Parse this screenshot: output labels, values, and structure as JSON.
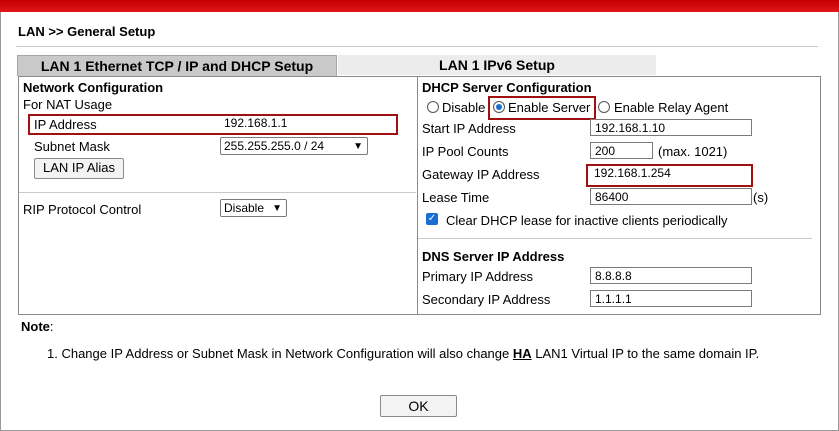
{
  "breadcrumb": "LAN >> General Setup",
  "tabs": [
    {
      "label": "LAN 1 Ethernet TCP / IP and DHCP Setup",
      "active": true
    },
    {
      "label": "LAN 1 IPv6 Setup",
      "active": false
    }
  ],
  "network": {
    "title": "Network Configuration",
    "nat_label": "For NAT Usage",
    "ip_label": "IP Address",
    "ip_value": "192.168.1.1",
    "mask_label": "Subnet Mask",
    "mask_value": "255.255.255.0 / 24",
    "alias_button": "LAN IP Alias",
    "rip_label": "RIP Protocol Control",
    "rip_value": "Disable"
  },
  "dhcp": {
    "title": "DHCP Server Configuration",
    "modes": [
      "Disable",
      "Enable Server",
      "Enable Relay Agent"
    ],
    "selected_mode": "Enable Server",
    "start_ip_label": "Start IP Address",
    "start_ip_value": "192.168.1.10",
    "pool_label": "IP Pool Counts",
    "pool_value": "200",
    "pool_note": "(max. 1021)",
    "gateway_label": "Gateway IP Address",
    "gateway_value": "192.168.1.254",
    "lease_label": "Lease Time",
    "lease_value": "86400",
    "lease_unit": "(s)",
    "clear_label": "Clear DHCP lease for inactive clients periodically",
    "clear_checked": true
  },
  "dns": {
    "title": "DNS Server IP Address",
    "primary_label": "Primary IP Address",
    "primary_value": "8.8.8.8",
    "secondary_label": "Secondary IP Address",
    "secondary_value": "1.1.1.1"
  },
  "note": {
    "title": "Note",
    "colon": ":",
    "item_prefix": "1. Change IP Address or Subnet Mask in Network Configuration will also change ",
    "item_ha": "HA",
    "item_suffix": " LAN1 Virtual IP to the same domain IP."
  },
  "ok_button": "OK",
  "colors": {
    "top_bar": "#d01010",
    "highlight": "#a01010",
    "accent": "#1a6fd1"
  }
}
